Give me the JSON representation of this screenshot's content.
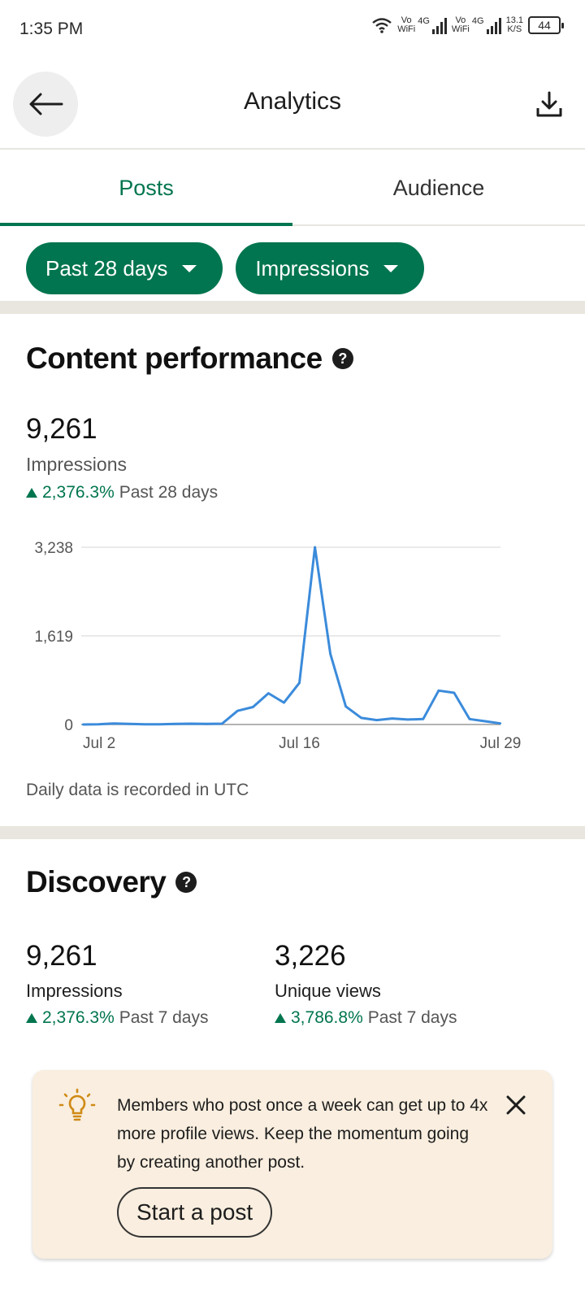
{
  "status_bar": {
    "time": "1:35 PM",
    "sim1_top": "Vo",
    "sim1_bottom": "WiFi",
    "sim1_net": "4G",
    "sim2_top": "Vo",
    "sim2_bottom": "WiFi",
    "sim2_net": "4G",
    "speed_value": "13.1",
    "speed_unit": "K/S",
    "battery": "44"
  },
  "header": {
    "title": "Analytics",
    "back_icon": "arrow-left-icon",
    "download_icon": "download-icon"
  },
  "tabs": [
    {
      "label": "Posts",
      "active": true
    },
    {
      "label": "Audience",
      "active": false
    }
  ],
  "filters": {
    "period": "Past 28 days",
    "metric": "Impressions"
  },
  "content_performance": {
    "title": "Content performance",
    "help_icon": "?",
    "value": "9,261",
    "label": "Impressions",
    "change": "2,376.3%",
    "change_period": "Past 28 days",
    "note": "Daily data is recorded in UTC"
  },
  "chart_data": {
    "type": "line",
    "x": [
      "Jul 2",
      "Jul 3",
      "Jul 4",
      "Jul 5",
      "Jul 6",
      "Jul 7",
      "Jul 8",
      "Jul 9",
      "Jul 10",
      "Jul 11",
      "Jul 12",
      "Jul 13",
      "Jul 14",
      "Jul 15",
      "Jul 16",
      "Jul 17",
      "Jul 18",
      "Jul 19",
      "Jul 20",
      "Jul 21",
      "Jul 22",
      "Jul 23",
      "Jul 24",
      "Jul 25",
      "Jul 26",
      "Jul 27",
      "Jul 28",
      "Jul 29"
    ],
    "series": [
      {
        "values": [
          0,
          5,
          20,
          10,
          5,
          5,
          10,
          15,
          10,
          15,
          250,
          320,
          570,
          400,
          760,
          3238,
          1290,
          330,
          120,
          80,
          110,
          90,
          100,
          620,
          580,
          100,
          60,
          20
        ]
      }
    ],
    "x_tick_labels": [
      "Jul 2",
      "Jul 16",
      "Jul 29"
    ],
    "y_tick_labels": [
      "0",
      "1,619",
      "3,238"
    ],
    "ylim": [
      0,
      3238
    ],
    "grid": true,
    "color": "#3b8bdb"
  },
  "discovery": {
    "title": "Discovery",
    "help_icon": "?",
    "metrics": [
      {
        "value": "9,261",
        "label": "Impressions",
        "change": "2,376.3%",
        "period": "Past 7 days"
      },
      {
        "value": "3,226",
        "label": "Unique views",
        "change": "3,786.8%",
        "period": "Past 7 days"
      }
    ]
  },
  "tip": {
    "icon": "lightbulb-icon",
    "text": "Members who post once a week can get up to 4x more profile views. Keep the momentum going by creating another post.",
    "button": "Start a post",
    "close_icon": "close-icon"
  },
  "colors": {
    "accent": "#01754f",
    "line": "#3b8bdb",
    "tip_bg": "#f9eedf",
    "divider": "#e9e6df"
  }
}
